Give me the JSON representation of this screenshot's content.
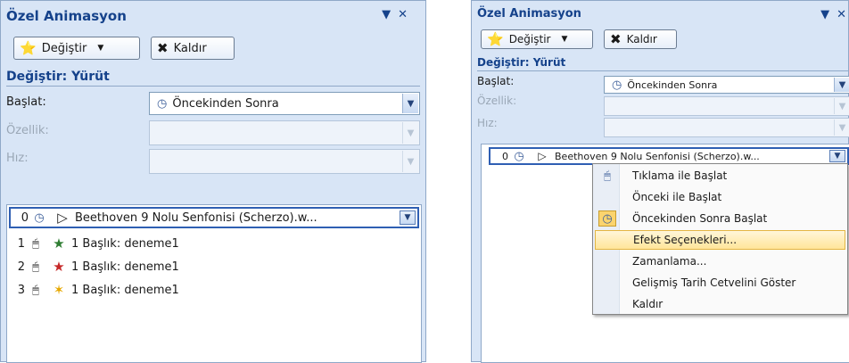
{
  "panes": [
    {
      "title": "Özel Animasyon",
      "change_btn": "Değiştir",
      "remove_btn": "Kaldır",
      "section": "Değiştir: Yürüt",
      "start_label": "Başlat:",
      "start_value": "Öncekinden Sonra",
      "property_label": "Özellik:",
      "speed_label": "Hız:",
      "list": [
        {
          "num": "0",
          "icon": "clock",
          "text": "Beethoven 9 Nolu Senfonisi (Scherzo).w..."
        },
        {
          "num": "1",
          "icon": "mouse",
          "text": "1 Başlık: deneme1"
        },
        {
          "num": "2",
          "icon": "mouse",
          "text": "1 Başlık: deneme1"
        },
        {
          "num": "3",
          "icon": "mouse",
          "text": "1 Başlık: deneme1"
        }
      ]
    },
    {
      "title": "Özel Animasyon",
      "change_btn": "Değiştir",
      "remove_btn": "Kaldır",
      "section": "Değiştir: Yürüt",
      "start_label": "Başlat:",
      "start_value": "Öncekinden Sonra",
      "property_label": "Özellik:",
      "speed_label": "Hız:",
      "list": [
        {
          "num": "0",
          "icon": "clock",
          "text": "Beethoven 9 Nolu Senfonisi (Scherzo).w..."
        }
      ]
    }
  ],
  "context_menu": {
    "items": [
      {
        "label": "Tıklama ile Başlat",
        "icon": "mouse"
      },
      {
        "label": "Önceki ile Başlat",
        "icon": ""
      },
      {
        "label": "Öncekinden Sonra Başlat",
        "icon": "clock"
      },
      {
        "label": "Efekt Seçenekleri...",
        "icon": ""
      },
      {
        "label": "Zamanlama...",
        "icon": ""
      },
      {
        "label": "Gelişmiş Tarih Cetvelini Göster",
        "icon": ""
      },
      {
        "label": "Kaldır",
        "icon": ""
      }
    ],
    "highlighted": "Efekt Seçenekleri..."
  }
}
